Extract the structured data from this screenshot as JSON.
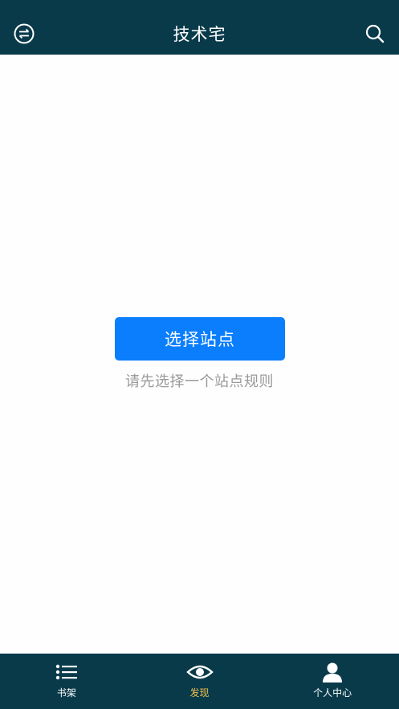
{
  "header": {
    "title": "技术宅",
    "left_icon": "swap-circle-icon",
    "right_icon": "search-icon"
  },
  "main": {
    "select_button_label": "选择站点",
    "hint_text": "请先选择一个站点规则"
  },
  "tabbar": {
    "active_index": 1,
    "active_color": "#f2c14e",
    "items": [
      {
        "label": "书架",
        "icon": "list-icon"
      },
      {
        "label": "发现",
        "icon": "eye-icon"
      },
      {
        "label": "个人中心",
        "icon": "user-icon"
      }
    ]
  },
  "colors": {
    "header_bg": "#083a4a",
    "button_bg": "#0a7efc",
    "hint_text": "#9a9a9a"
  }
}
